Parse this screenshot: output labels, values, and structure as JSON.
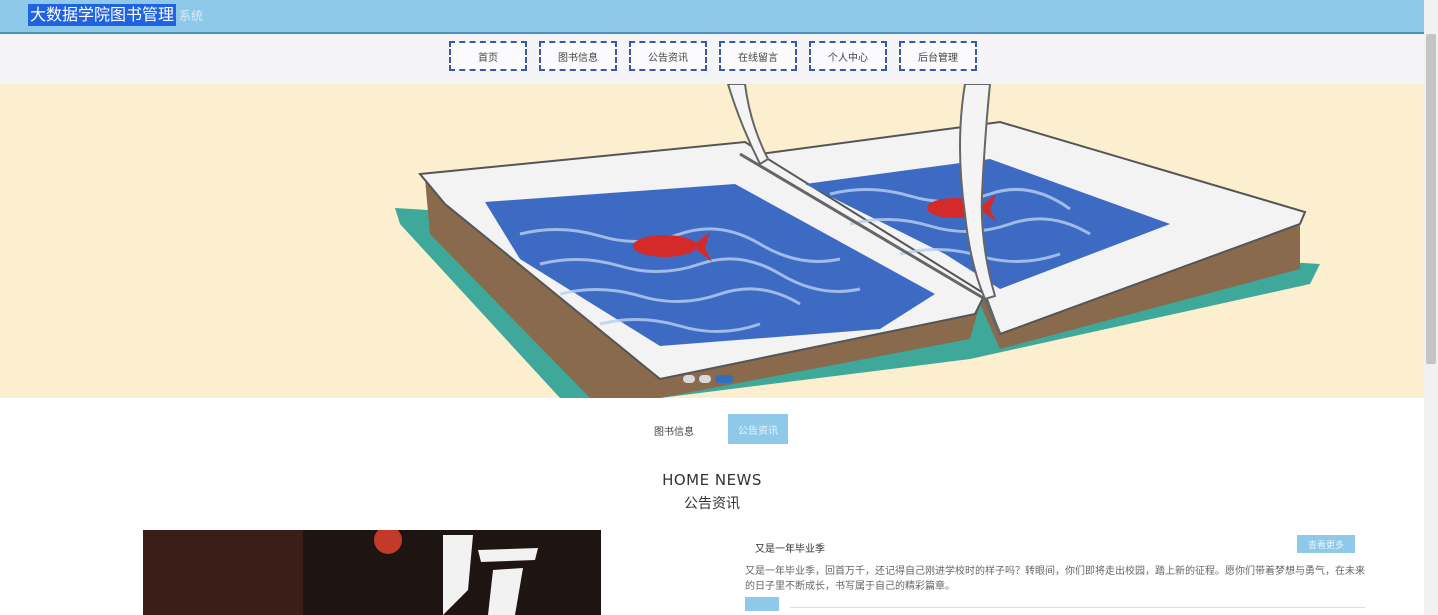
{
  "header": {
    "title": "大数据学院图书管理",
    "title_suffix": "系统"
  },
  "nav": {
    "items": [
      "首页",
      "图书信息",
      "公告资讯",
      "在线留言",
      "个人中心",
      "后台管理"
    ]
  },
  "banner": {
    "slide_count": 3,
    "active_slide": 3
  },
  "tabs": {
    "plain": "图书信息",
    "active": "公告资讯"
  },
  "news": {
    "heading_en": "HOME NEWS",
    "heading_zh": "公告资讯",
    "item": {
      "title": "又是一年毕业季",
      "more_label": "查看更多",
      "body": "又是一年毕业季，回首万千，还记得自己刚进学校时的样子吗？转眼间，你们即将走出校园，踏上新的征程。愿你们带着梦想与勇气，在未来的日子里不断成长，书写属于自己的精彩篇章。"
    }
  },
  "colors": {
    "topbar": "#8ec9ea",
    "accent": "#1f63e0",
    "banner_bg": "#fcefd0"
  }
}
